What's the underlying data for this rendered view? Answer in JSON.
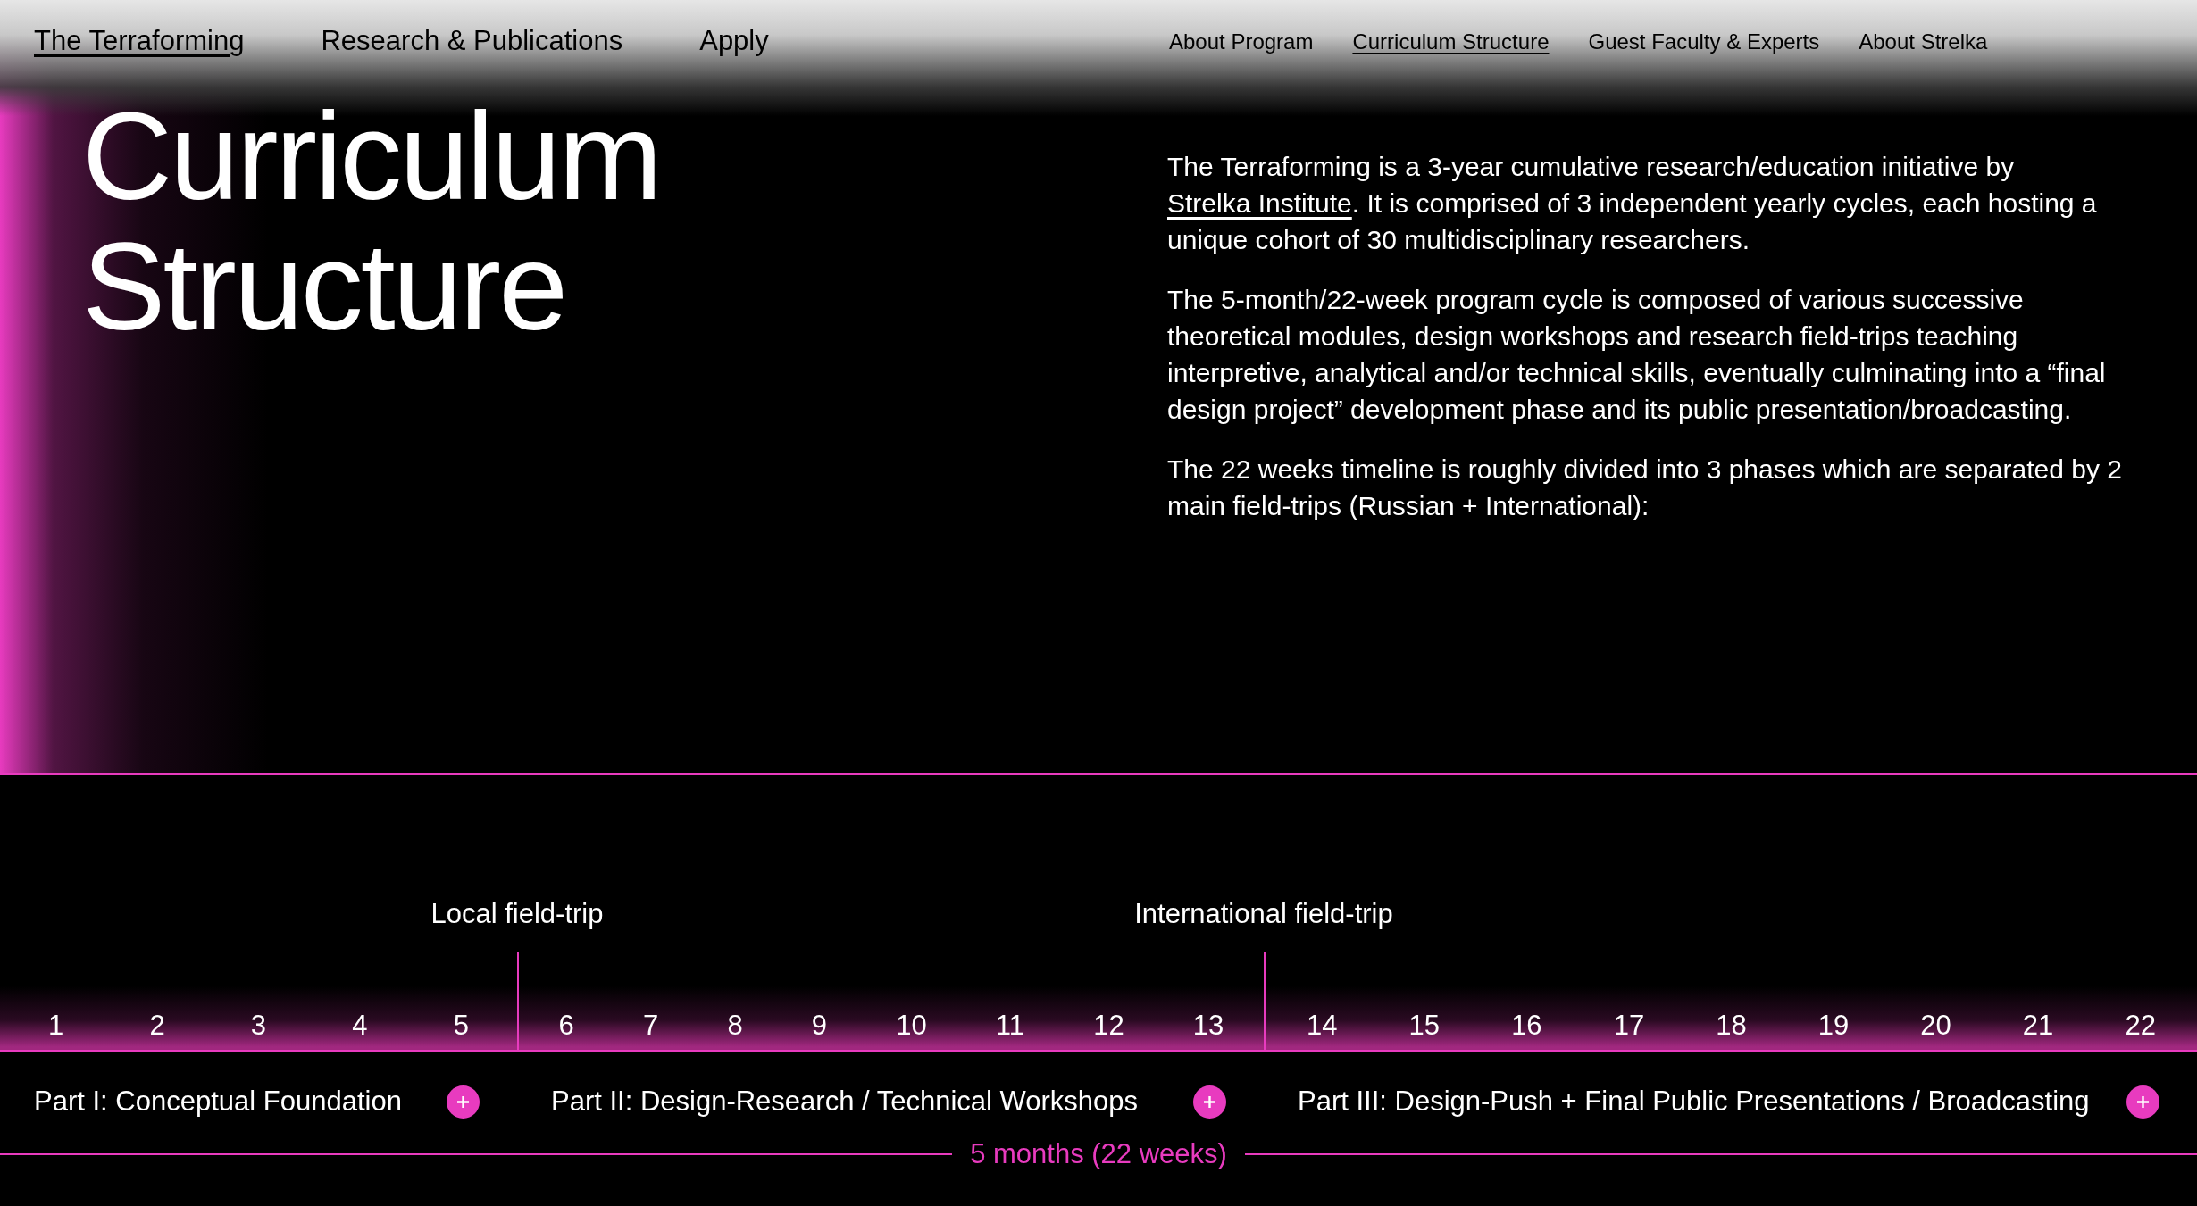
{
  "nav_left": [
    {
      "label": "The Terraforming",
      "selected": true
    },
    {
      "label": "Research & Publications",
      "selected": false
    },
    {
      "label": "Apply",
      "selected": false
    }
  ],
  "nav_right": [
    {
      "label": "About Program",
      "selected": false
    },
    {
      "label": "Curriculum Structure",
      "selected": true
    },
    {
      "label": "Guest Faculty & Experts",
      "selected": false
    },
    {
      "label": "About Strelka",
      "selected": false
    }
  ],
  "title": [
    "Curriculum",
    "Structure"
  ],
  "intro": [
    [
      {
        "kind": "text",
        "text": "The Terraforming is a 3-year cumulative research/education initiative by "
      },
      {
        "kind": "link",
        "text": "Strelka Institute"
      },
      {
        "kind": "text",
        "text": ". It is comprised of 3 independent yearly cycles, each hosting a unique cohort of 30 multidisciplinary researchers."
      }
    ],
    [
      {
        "kind": "text",
        "text": "The 5-month/22-week program cycle is composed of various successive theoretical modules, design workshops and research field-trips teaching interpretive, analytical and/or technical skills, eventually culminating into a “final design project” development phase and its public presentation/broadcasting."
      }
    ],
    [
      {
        "kind": "text",
        "text": "The 22 weeks timeline is roughly divided into 3 phases which are separated by 2 main field-trips (Russian + International):"
      }
    ]
  ],
  "timeline": {
    "field_trips": [
      "Local field-trip",
      "International field-trip"
    ],
    "phases": [
      {
        "weeks": [
          "1",
          "2",
          "3",
          "4",
          "5"
        ],
        "part": "Part I: Conceptual Foundation"
      },
      {
        "weeks": [
          "6",
          "7",
          "8",
          "9",
          "10",
          "11",
          "12",
          "13"
        ],
        "part": "Part II: Design-Research / Technical Workshops"
      },
      {
        "weeks": [
          "14",
          "15",
          "16",
          "17",
          "18",
          "19",
          "20",
          "21",
          "22"
        ],
        "part": "Part III: Design-Push + Final Public Presentations / Broadcasting"
      }
    ],
    "duration": "5 months (22 weeks)"
  }
}
